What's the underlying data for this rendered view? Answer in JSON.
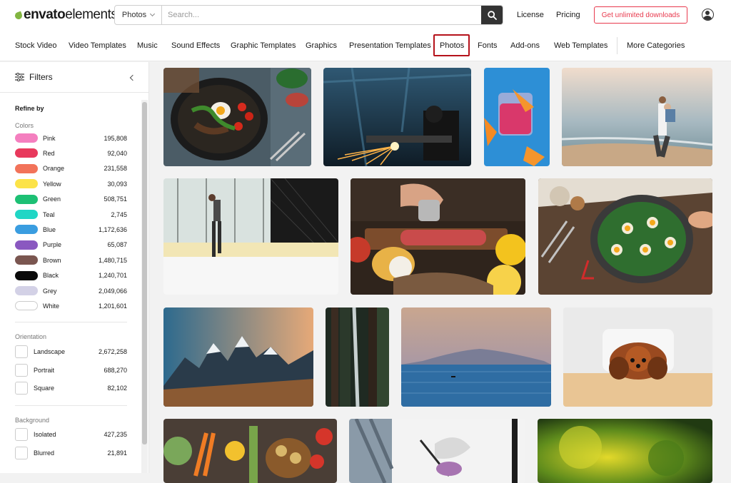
{
  "header": {
    "logo_bold": "envato",
    "logo_light": "elements",
    "search_category": "Photos",
    "search_placeholder": "Search...",
    "links": [
      "License",
      "Pricing"
    ],
    "cta": "Get unlimited downloads"
  },
  "categories": [
    "Stock Video",
    "Video Templates",
    "Music",
    "Sound Effects",
    "Graphic Templates",
    "Graphics",
    "Presentation Templates",
    "Photos",
    "Fonts",
    "Add-ons",
    "Web Templates",
    "More Categories"
  ],
  "active_category": "Photos",
  "sidebar": {
    "title": "Filters",
    "refine_by": "Refine by",
    "colors_label": "Colors",
    "colors": [
      {
        "name": "Pink",
        "count": "195,808",
        "hex": "#f47fbf"
      },
      {
        "name": "Red",
        "count": "92,040",
        "hex": "#e8395c"
      },
      {
        "name": "Orange",
        "count": "231,558",
        "hex": "#f2735a"
      },
      {
        "name": "Yellow",
        "count": "30,093",
        "hex": "#fce348"
      },
      {
        "name": "Green",
        "count": "508,751",
        "hex": "#1dc074"
      },
      {
        "name": "Teal",
        "count": "2,745",
        "hex": "#20d6c5"
      },
      {
        "name": "Blue",
        "count": "1,172,636",
        "hex": "#3a9de0"
      },
      {
        "name": "Purple",
        "count": "65,087",
        "hex": "#8a58c0"
      },
      {
        "name": "Brown",
        "count": "1,480,715",
        "hex": "#7a5650"
      },
      {
        "name": "Black",
        "count": "1,240,701",
        "hex": "#0a0a0a"
      },
      {
        "name": "Grey",
        "count": "2,049,066",
        "hex": "#d3d1e6"
      },
      {
        "name": "White",
        "count": "1,201,601",
        "hex": "#ffffff"
      }
    ],
    "orientation_label": "Orientation",
    "orientation": [
      {
        "name": "Landscape",
        "count": "2,672,258"
      },
      {
        "name": "Portrait",
        "count": "688,270"
      },
      {
        "name": "Square",
        "count": "82,102"
      }
    ],
    "background_label": "Background",
    "background": [
      {
        "name": "Isolated",
        "count": "427,235"
      },
      {
        "name": "Blurred",
        "count": "21,891"
      }
    ]
  }
}
